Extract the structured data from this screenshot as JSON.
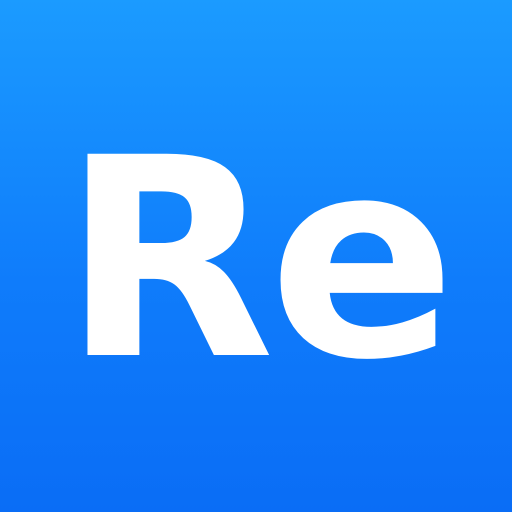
{
  "icon": {
    "logo_text": "Re",
    "colors": {
      "background_top": "#1b9bff",
      "background_bottom": "#0a6df6",
      "text": "#ffffff"
    }
  }
}
